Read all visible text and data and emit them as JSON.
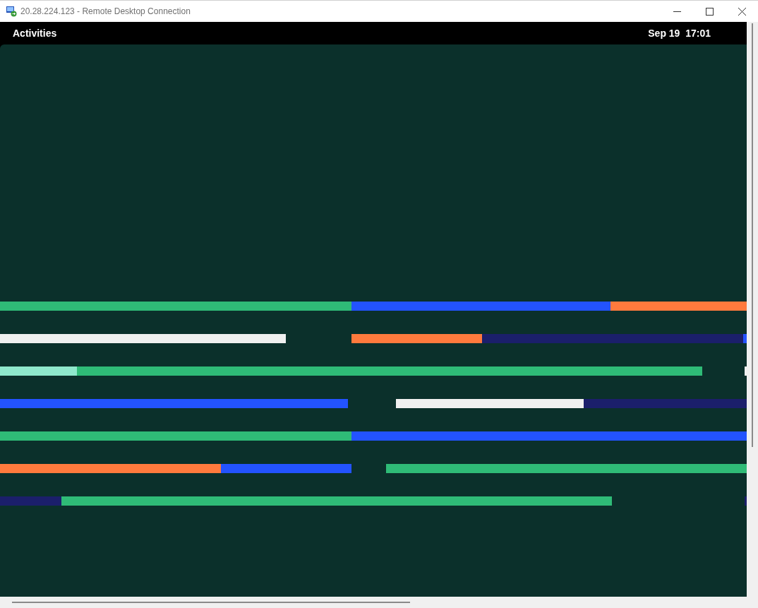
{
  "window": {
    "title": "20.28.224.123 - Remote Desktop Connection"
  },
  "top_bar": {
    "activities": "Activities",
    "clock": "Sep 19  17:01"
  }
}
